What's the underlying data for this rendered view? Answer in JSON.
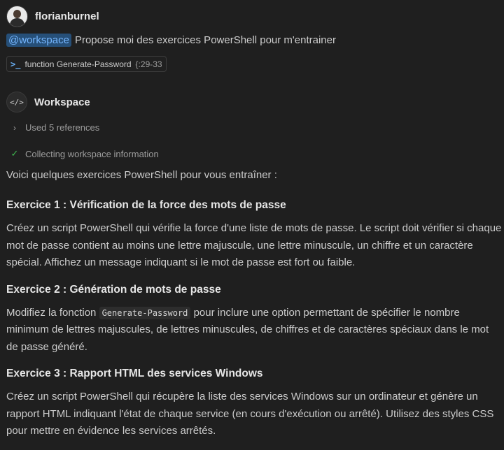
{
  "user": {
    "name": "florianburnel",
    "mention": "@workspace",
    "prompt": "Propose moi des exercices PowerShell pour m'entrainer"
  },
  "reference_chip": {
    "icon": "powershell-icon",
    "label": "function Generate-Password",
    "range": "{:29-33"
  },
  "assistant": {
    "name": "Workspace",
    "icon": "code-icon",
    "references": "Used 5 references",
    "status": "Collecting workspace information"
  },
  "response": {
    "intro": "Voici quelques exercices PowerShell pour vous entraîner :",
    "exercises": [
      {
        "title": "Exercice 1 : Vérification de la force des mots de passe",
        "body": "Créez un script PowerShell qui vérifie la force d'une liste de mots de passe. Le script doit vérifier si chaque mot de passe contient au moins une lettre majuscule, une lettre minuscule, un chiffre et un caractère spécial. Affichez un message indiquant si le mot de passe est fort ou faible."
      },
      {
        "title": "Exercice 2 : Génération de mots de passe",
        "body_before": "Modifiez la fonction",
        "code": "Generate-Password",
        "body_after": "pour inclure une option permettant de spécifier le nombre minimum de lettres majuscules, de lettres minuscules, de chiffres et de caractères spéciaux dans le mot de passe généré."
      },
      {
        "title": "Exercice 3 : Rapport HTML des services Windows",
        "body": "Créez un script PowerShell qui récupère la liste des services Windows sur un ordinateur et génère un rapport HTML indiquant l'état de chaque service (en cours d'exécution ou arrêté). Utilisez des styles CSS pour mettre en évidence les services arrêtés."
      }
    ]
  },
  "colors": {
    "background": "#1f1f1f",
    "mention_bg": "#264f78",
    "mention_fg": "#75b6ff",
    "check": "#3fb950"
  }
}
